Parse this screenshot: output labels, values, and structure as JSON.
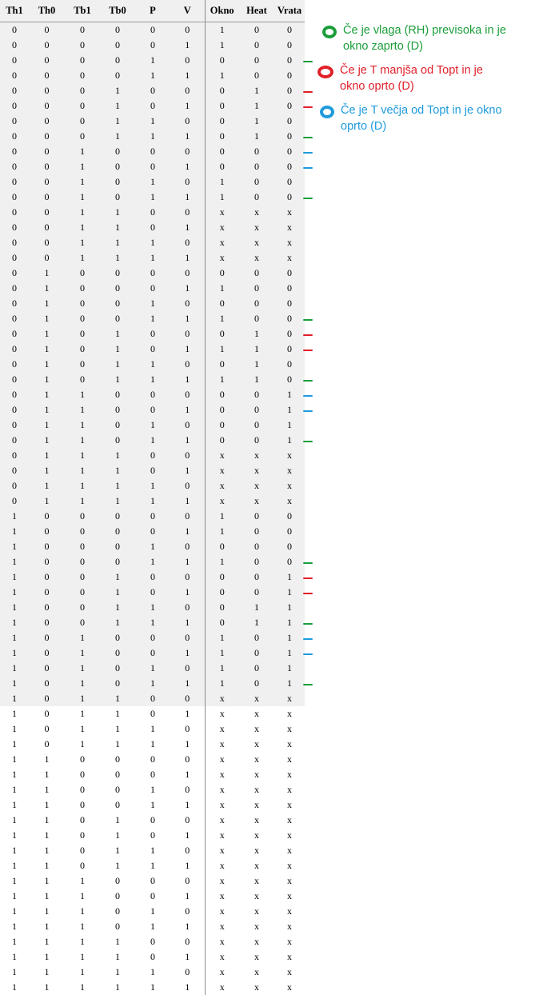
{
  "colors": {
    "green": "#1a9e3a",
    "red": "#e0202a",
    "blue": "#1e9bdc"
  },
  "headers": [
    "Th1",
    "Th0",
    "Tb1",
    "Tb0",
    "P",
    "V",
    "Okno",
    "Heat",
    "Vrata"
  ],
  "rows": [
    [
      "0",
      "0",
      "0",
      "0",
      "0",
      "0",
      "1",
      "0",
      "0"
    ],
    [
      "0",
      "0",
      "0",
      "0",
      "0",
      "1",
      "1",
      "0",
      "0"
    ],
    [
      "0",
      "0",
      "0",
      "0",
      "1",
      "0",
      "0",
      "0",
      "0"
    ],
    [
      "0",
      "0",
      "0",
      "0",
      "1",
      "1",
      "1",
      "0",
      "0"
    ],
    [
      "0",
      "0",
      "0",
      "1",
      "0",
      "0",
      "0",
      "1",
      "0"
    ],
    [
      "0",
      "0",
      "0",
      "1",
      "0",
      "1",
      "0",
      "1",
      "0"
    ],
    [
      "0",
      "0",
      "0",
      "1",
      "1",
      "0",
      "0",
      "1",
      "0"
    ],
    [
      "0",
      "0",
      "0",
      "1",
      "1",
      "1",
      "0",
      "1",
      "0"
    ],
    [
      "0",
      "0",
      "1",
      "0",
      "0",
      "0",
      "0",
      "0",
      "0"
    ],
    [
      "0",
      "0",
      "1",
      "0",
      "0",
      "1",
      "0",
      "0",
      "0"
    ],
    [
      "0",
      "0",
      "1",
      "0",
      "1",
      "0",
      "1",
      "0",
      "0"
    ],
    [
      "0",
      "0",
      "1",
      "0",
      "1",
      "1",
      "1",
      "0",
      "0"
    ],
    [
      "0",
      "0",
      "1",
      "1",
      "0",
      "0",
      "x",
      "x",
      "x"
    ],
    [
      "0",
      "0",
      "1",
      "1",
      "0",
      "1",
      "x",
      "x",
      "x"
    ],
    [
      "0",
      "0",
      "1",
      "1",
      "1",
      "0",
      "x",
      "x",
      "x"
    ],
    [
      "0",
      "0",
      "1",
      "1",
      "1",
      "1",
      "x",
      "x",
      "x"
    ],
    [
      "0",
      "1",
      "0",
      "0",
      "0",
      "0",
      "0",
      "0",
      "0"
    ],
    [
      "0",
      "1",
      "0",
      "0",
      "0",
      "1",
      "1",
      "0",
      "0"
    ],
    [
      "0",
      "1",
      "0",
      "0",
      "1",
      "0",
      "0",
      "0",
      "0"
    ],
    [
      "0",
      "1",
      "0",
      "0",
      "1",
      "1",
      "1",
      "0",
      "0"
    ],
    [
      "0",
      "1",
      "0",
      "1",
      "0",
      "0",
      "0",
      "1",
      "0"
    ],
    [
      "0",
      "1",
      "0",
      "1",
      "0",
      "1",
      "1",
      "1",
      "0"
    ],
    [
      "0",
      "1",
      "0",
      "1",
      "1",
      "0",
      "0",
      "1",
      "0"
    ],
    [
      "0",
      "1",
      "0",
      "1",
      "1",
      "1",
      "1",
      "1",
      "0"
    ],
    [
      "0",
      "1",
      "1",
      "0",
      "0",
      "0",
      "0",
      "0",
      "1"
    ],
    [
      "0",
      "1",
      "1",
      "0",
      "0",
      "1",
      "0",
      "0",
      "1"
    ],
    [
      "0",
      "1",
      "1",
      "0",
      "1",
      "0",
      "0",
      "0",
      "1"
    ],
    [
      "0",
      "1",
      "1",
      "0",
      "1",
      "1",
      "0",
      "0",
      "1"
    ],
    [
      "0",
      "1",
      "1",
      "1",
      "0",
      "0",
      "x",
      "x",
      "x"
    ],
    [
      "0",
      "1",
      "1",
      "1",
      "0",
      "1",
      "x",
      "x",
      "x"
    ],
    [
      "0",
      "1",
      "1",
      "1",
      "1",
      "0",
      "x",
      "x",
      "x"
    ],
    [
      "0",
      "1",
      "1",
      "1",
      "1",
      "1",
      "x",
      "x",
      "x"
    ],
    [
      "1",
      "0",
      "0",
      "0",
      "0",
      "0",
      "1",
      "0",
      "0"
    ],
    [
      "1",
      "0",
      "0",
      "0",
      "0",
      "1",
      "1",
      "0",
      "0"
    ],
    [
      "1",
      "0",
      "0",
      "0",
      "1",
      "0",
      "0",
      "0",
      "0"
    ],
    [
      "1",
      "0",
      "0",
      "0",
      "1",
      "1",
      "1",
      "0",
      "0"
    ],
    [
      "1",
      "0",
      "0",
      "1",
      "0",
      "0",
      "0",
      "0",
      "1"
    ],
    [
      "1",
      "0",
      "0",
      "1",
      "0",
      "1",
      "0",
      "0",
      "1"
    ],
    [
      "1",
      "0",
      "0",
      "1",
      "1",
      "0",
      "0",
      "1",
      "1"
    ],
    [
      "1",
      "0",
      "0",
      "1",
      "1",
      "1",
      "0",
      "1",
      "1"
    ],
    [
      "1",
      "0",
      "1",
      "0",
      "0",
      "0",
      "1",
      "0",
      "1"
    ],
    [
      "1",
      "0",
      "1",
      "0",
      "0",
      "1",
      "1",
      "0",
      "1"
    ],
    [
      "1",
      "0",
      "1",
      "0",
      "1",
      "0",
      "1",
      "0",
      "1"
    ],
    [
      "1",
      "0",
      "1",
      "0",
      "1",
      "1",
      "1",
      "0",
      "1"
    ],
    [
      "1",
      "0",
      "1",
      "1",
      "0",
      "0",
      "x",
      "x",
      "x"
    ],
    [
      "1",
      "0",
      "1",
      "1",
      "0",
      "1",
      "x",
      "x",
      "x"
    ],
    [
      "1",
      "0",
      "1",
      "1",
      "1",
      "0",
      "x",
      "x",
      "x"
    ],
    [
      "1",
      "0",
      "1",
      "1",
      "1",
      "1",
      "x",
      "x",
      "x"
    ],
    [
      "1",
      "1",
      "0",
      "0",
      "0",
      "0",
      "x",
      "x",
      "x"
    ],
    [
      "1",
      "1",
      "0",
      "0",
      "0",
      "1",
      "x",
      "x",
      "x"
    ],
    [
      "1",
      "1",
      "0",
      "0",
      "1",
      "0",
      "x",
      "x",
      "x"
    ],
    [
      "1",
      "1",
      "0",
      "0",
      "1",
      "1",
      "x",
      "x",
      "x"
    ],
    [
      "1",
      "1",
      "0",
      "1",
      "0",
      "0",
      "x",
      "x",
      "x"
    ],
    [
      "1",
      "1",
      "0",
      "1",
      "0",
      "1",
      "x",
      "x",
      "x"
    ],
    [
      "1",
      "1",
      "0",
      "1",
      "1",
      "0",
      "x",
      "x",
      "x"
    ],
    [
      "1",
      "1",
      "0",
      "1",
      "1",
      "1",
      "x",
      "x",
      "x"
    ],
    [
      "1",
      "1",
      "1",
      "0",
      "0",
      "0",
      "x",
      "x",
      "x"
    ],
    [
      "1",
      "1",
      "1",
      "0",
      "0",
      "1",
      "x",
      "x",
      "x"
    ],
    [
      "1",
      "1",
      "1",
      "0",
      "1",
      "0",
      "x",
      "x",
      "x"
    ],
    [
      "1",
      "1",
      "1",
      "0",
      "1",
      "1",
      "x",
      "x",
      "x"
    ],
    [
      "1",
      "1",
      "1",
      "1",
      "0",
      "0",
      "x",
      "x",
      "x"
    ],
    [
      "1",
      "1",
      "1",
      "1",
      "0",
      "1",
      "x",
      "x",
      "x"
    ],
    [
      "1",
      "1",
      "1",
      "1",
      "1",
      "0",
      "x",
      "x",
      "x"
    ],
    [
      "1",
      "1",
      "1",
      "1",
      "1",
      "1",
      "x",
      "x",
      "x"
    ]
  ],
  "legend": [
    {
      "color": "green",
      "text_lines": [
        "Če je vlaga (RH) previsoka in je",
        "okno zaprto (D)"
      ]
    },
    {
      "color": "red",
      "text_lines": [
        "Če je T manjša od Topt in je",
        "okno oprto (D)"
      ]
    },
    {
      "color": "blue",
      "text_lines": [
        "Če je T večja od Topt in je okno",
        "oprto (D)"
      ]
    }
  ],
  "row_marks": [
    {
      "row": 3,
      "color": "green"
    },
    {
      "row": 5,
      "color": "red"
    },
    {
      "row": 6,
      "color": "red"
    },
    {
      "row": 8,
      "color": "green"
    },
    {
      "row": 9,
      "color": "blue"
    },
    {
      "row": 10,
      "color": "blue"
    },
    {
      "row": 12,
      "color": "green"
    },
    {
      "row": 20,
      "color": "green"
    },
    {
      "row": 21,
      "color": "red"
    },
    {
      "row": 22,
      "color": "red"
    },
    {
      "row": 24,
      "color": "green"
    },
    {
      "row": 25,
      "color": "blue"
    },
    {
      "row": 26,
      "color": "blue"
    },
    {
      "row": 28,
      "color": "green"
    },
    {
      "row": 36,
      "color": "green"
    },
    {
      "row": 37,
      "color": "red"
    },
    {
      "row": 38,
      "color": "red"
    },
    {
      "row": 40,
      "color": "green"
    },
    {
      "row": 41,
      "color": "blue"
    },
    {
      "row": 42,
      "color": "blue"
    },
    {
      "row": 44,
      "color": "green"
    }
  ]
}
